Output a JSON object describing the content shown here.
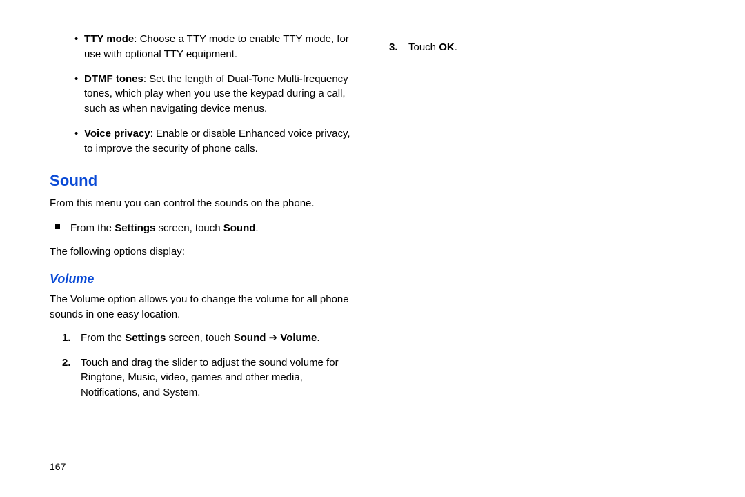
{
  "left_column": {
    "bullet_items": [
      {
        "title": "TTY mode",
        "text": ": Choose a TTY mode to enable TTY mode, for use with optional TTY equipment."
      },
      {
        "title": "DTMF tones",
        "text": ": Set the length of Dual-Tone Multi-frequency tones, which play when you use the keypad during a call, such as when navigating device menus."
      },
      {
        "title": "Voice privacy",
        "text": ": Enable or disable Enhanced voice privacy, to improve the security of phone calls."
      }
    ],
    "heading_sound": "Sound",
    "sound_intro": "From this menu you can control the sounds on the phone.",
    "square_line_pre": "From the ",
    "square_line_bold1": "Settings",
    "square_line_mid": " screen, touch ",
    "square_line_bold2": "Sound",
    "square_line_post": ".",
    "following_options": "The following options display:",
    "heading_volume": "Volume",
    "volume_intro": "The Volume option allows you to change the volume for all phone sounds in one easy location.",
    "steps": [
      {
        "num": "1.",
        "pre": "From the ",
        "b1": "Settings",
        "mid1": " screen, touch ",
        "b2": "Sound",
        "arrow": " ➔ ",
        "b3": "Volume",
        "post": "."
      },
      {
        "num": "2.",
        "text": "Touch and drag the slider to adjust the sound volume for Ringtone, Music, video, games and other media, Notifications, and System."
      }
    ]
  },
  "right_column": {
    "step3": {
      "num": "3.",
      "pre": "Touch ",
      "b1": "OK",
      "post": "."
    }
  },
  "page_number": "167"
}
